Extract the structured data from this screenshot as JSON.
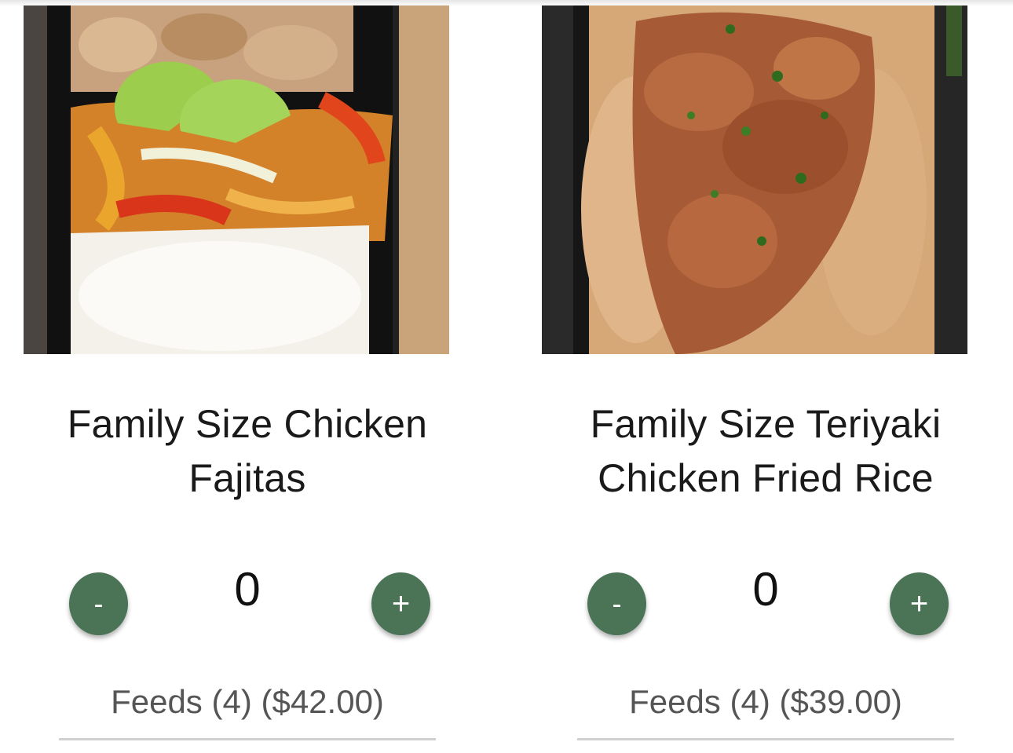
{
  "products": [
    {
      "title": "Family Size Chicken Fajitas",
      "image_alt": "Chicken fajitas with peppers, onions, lime wedges and white rice in a meal prep container",
      "quantity": "0",
      "decrement_label": "-",
      "increment_label": "+",
      "feeds_label": "Feeds (4) ($42.00)"
    },
    {
      "title": "Family Size Teriyaki Chicken Fried Rice",
      "image_alt": "Teriyaki chicken over fried rice garnished with parsley in a meal prep container",
      "quantity": "0",
      "decrement_label": "-",
      "increment_label": "+",
      "feeds_label": "Feeds (4) ($39.00)"
    }
  ],
  "colors": {
    "button_green": "#4a7455",
    "divider": "#d0d0d0",
    "feeds_text": "#555555"
  }
}
